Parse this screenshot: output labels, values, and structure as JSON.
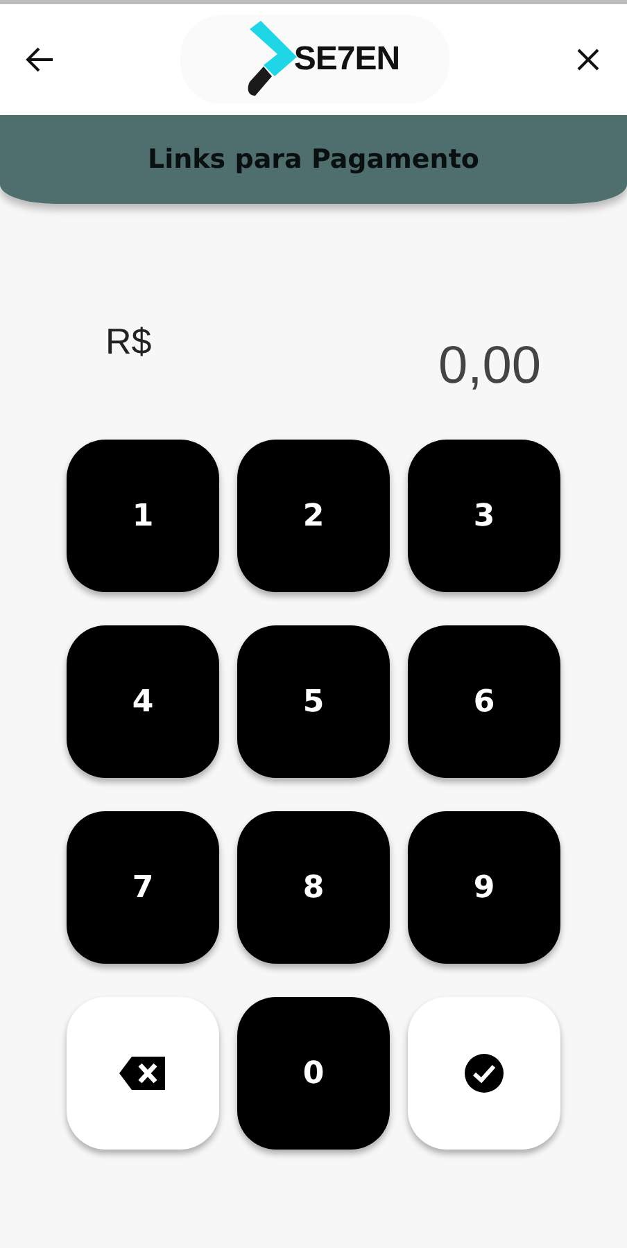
{
  "header": {
    "logo": "SE7EN"
  },
  "title": "Links para Pagamento",
  "amount": {
    "currency": "R$",
    "value": "0,00"
  },
  "keys": [
    {
      "kind": "digit",
      "label": "1"
    },
    {
      "kind": "digit",
      "label": "2"
    },
    {
      "kind": "digit",
      "label": "3"
    },
    {
      "kind": "digit",
      "label": "4"
    },
    {
      "kind": "digit",
      "label": "5"
    },
    {
      "kind": "digit",
      "label": "6"
    },
    {
      "kind": "digit",
      "label": "7"
    },
    {
      "kind": "digit",
      "label": "8"
    },
    {
      "kind": "digit",
      "label": "9"
    },
    {
      "kind": "backspace"
    },
    {
      "kind": "digit",
      "label": "0"
    },
    {
      "kind": "confirm"
    }
  ]
}
